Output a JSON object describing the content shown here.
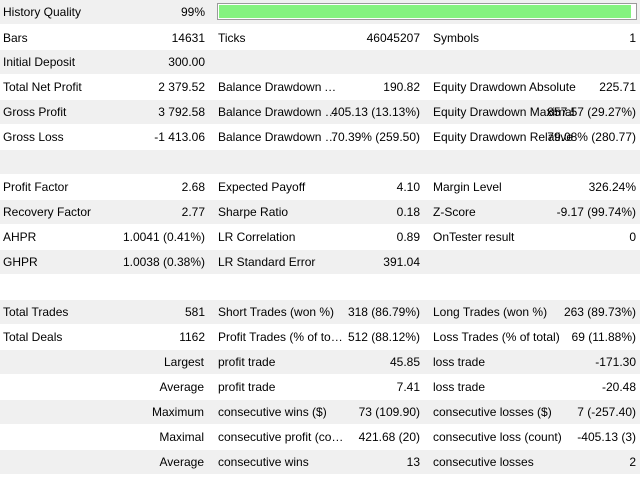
{
  "history_quality": {
    "label": "History Quality",
    "value": "99%",
    "fill_fraction": 0.99,
    "bar_color": "#84f37f"
  },
  "row_bars": {
    "bars_label": "Bars",
    "bars_value": "14631",
    "ticks_label": "Ticks",
    "ticks_value": "46045207",
    "symbols_label": "Symbols",
    "symbols_value": "1"
  },
  "row_deposit": {
    "label": "Initial Deposit",
    "value": "300.00"
  },
  "row_net": {
    "c1_label": "Total Net Profit",
    "c1_value": "2 379.52",
    "c2_label": "Balance Drawdown Absol...",
    "c2_value": "190.82",
    "c3_label": "Equity Drawdown Absolute",
    "c3_value": "225.71"
  },
  "row_gross_profit": {
    "c1_label": "Gross Profit",
    "c1_value": "3 792.58",
    "c2_label": "Balance Drawdown Maxi...",
    "c2_value": "405.13 (13.13%)",
    "c3_label": "Equity Drawdown Maximal",
    "c3_value": "857.57 (29.27%)"
  },
  "row_gross_loss": {
    "c1_label": "Gross Loss",
    "c1_value": "-1 413.06",
    "c2_label": "Balance Drawdown Relative",
    "c2_value": "70.39% (259.50)",
    "c3_label": "Equity Drawdown Relative",
    "c3_value": "79.08% (280.77)"
  },
  "row_profit_factor": {
    "c1_label": "Profit Factor",
    "c1_value": "2.68",
    "c2_label": "Expected Payoff",
    "c2_value": "4.10",
    "c3_label": "Margin Level",
    "c3_value": "326.24%"
  },
  "row_recovery": {
    "c1_label": "Recovery Factor",
    "c1_value": "2.77",
    "c2_label": "Sharpe Ratio",
    "c2_value": "0.18",
    "c3_label": "Z-Score",
    "c3_value": "-9.17 (99.74%)"
  },
  "row_ahpr": {
    "c1_label": "AHPR",
    "c1_value": "1.0041 (0.41%)",
    "c2_label": "LR Correlation",
    "c2_value": "0.89",
    "c3_label": "OnTester result",
    "c3_value": "0"
  },
  "row_ghpr": {
    "c1_label": "GHPR",
    "c1_value": "1.0038 (0.38%)",
    "c2_label": "LR Standard Error",
    "c2_value": "391.04"
  },
  "row_trades": {
    "c1_label": "Total Trades",
    "c1_value": "581",
    "c2_label": "Short Trades (won %)",
    "c2_value": "318 (86.79%)",
    "c3_label": "Long Trades (won %)",
    "c3_value": "263 (89.73%)"
  },
  "row_deals": {
    "c1_label": "Total Deals",
    "c1_value": "1162",
    "c2_label": "Profit Trades (% of total)",
    "c2_value": "512 (88.12%)",
    "c3_label": "Loss Trades (% of total)",
    "c3_value": "69 (11.88%)"
  },
  "row_largest": {
    "c1_label": "Largest",
    "c2_label": "profit trade",
    "c2_value": "45.85",
    "c3_label": "loss trade",
    "c3_value": "-171.30"
  },
  "row_average": {
    "c1_label": "Average",
    "c2_label": "profit trade",
    "c2_value": "7.41",
    "c3_label": "loss trade",
    "c3_value": "-20.48"
  },
  "row_maximum": {
    "c1_label": "Maximum",
    "c2_label": "consecutive wins ($)",
    "c2_value": "73 (109.90)",
    "c3_label": "consecutive losses ($)",
    "c3_value": "7 (-257.40)"
  },
  "row_maximal": {
    "c1_label": "Maximal",
    "c2_label": "consecutive profit (count)",
    "c2_value": "421.68 (20)",
    "c3_label": "consecutive loss (count)",
    "c3_value": "-405.13 (3)"
  },
  "row_average_consec": {
    "c1_label": "Average",
    "c2_label": "consecutive wins",
    "c2_value": "13",
    "c3_label": "consecutive losses",
    "c3_value": "2"
  }
}
